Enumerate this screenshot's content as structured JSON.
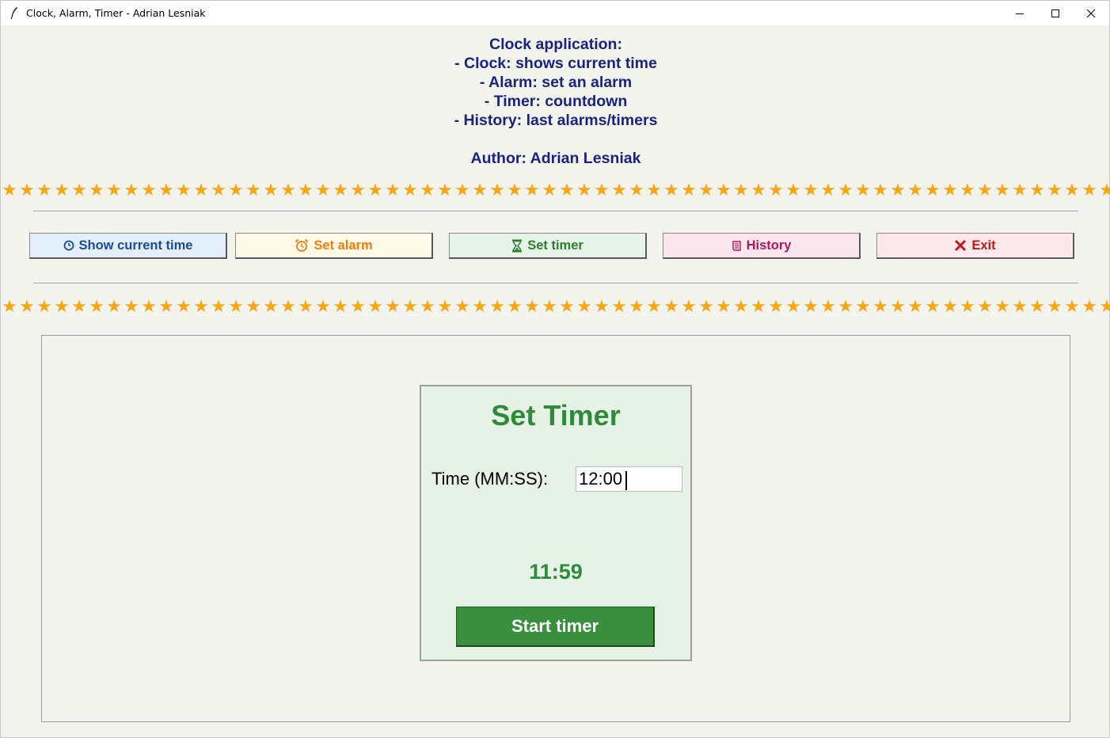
{
  "window": {
    "title": "Clock, Alarm, Timer - Adrian Lesniak"
  },
  "description": {
    "lines": [
      "Clock application:",
      "- Clock: shows current time",
      "- Alarm: set an alarm",
      "- Timer: countdown",
      "- History: last alarms/timers",
      "",
      "Author: Adrian Lesniak"
    ]
  },
  "decoration": {
    "star_glyph": "★",
    "star_color": "#f5a71a"
  },
  "nav": {
    "show_time": {
      "label": "Show current time",
      "icon": "clock-icon",
      "color": "#1a4a9c",
      "bg": "#e3f0fc"
    },
    "set_alarm": {
      "label": "Set alarm",
      "icon": "alarm-clock-icon",
      "color": "#f07c0c",
      "bg": "#fffbe8"
    },
    "set_timer": {
      "label": "Set timer",
      "icon": "hourglass-icon",
      "color": "#2e7d32",
      "bg": "#e6f4e8"
    },
    "history": {
      "label": "History",
      "icon": "scroll-icon",
      "color": "#b0185a",
      "bg": "#fbe6ee"
    },
    "exit": {
      "label": "Exit",
      "icon": "close-x-icon",
      "color": "#c0181c",
      "bg": "#fde8ec"
    }
  },
  "timer": {
    "title": "Set Timer",
    "time_label": "Time (MM:SS):",
    "time_value": "12:00",
    "countdown": "11:59",
    "start_label": "Start timer",
    "accent": "#2e8b3a",
    "button_bg": "#3a8f3f"
  }
}
